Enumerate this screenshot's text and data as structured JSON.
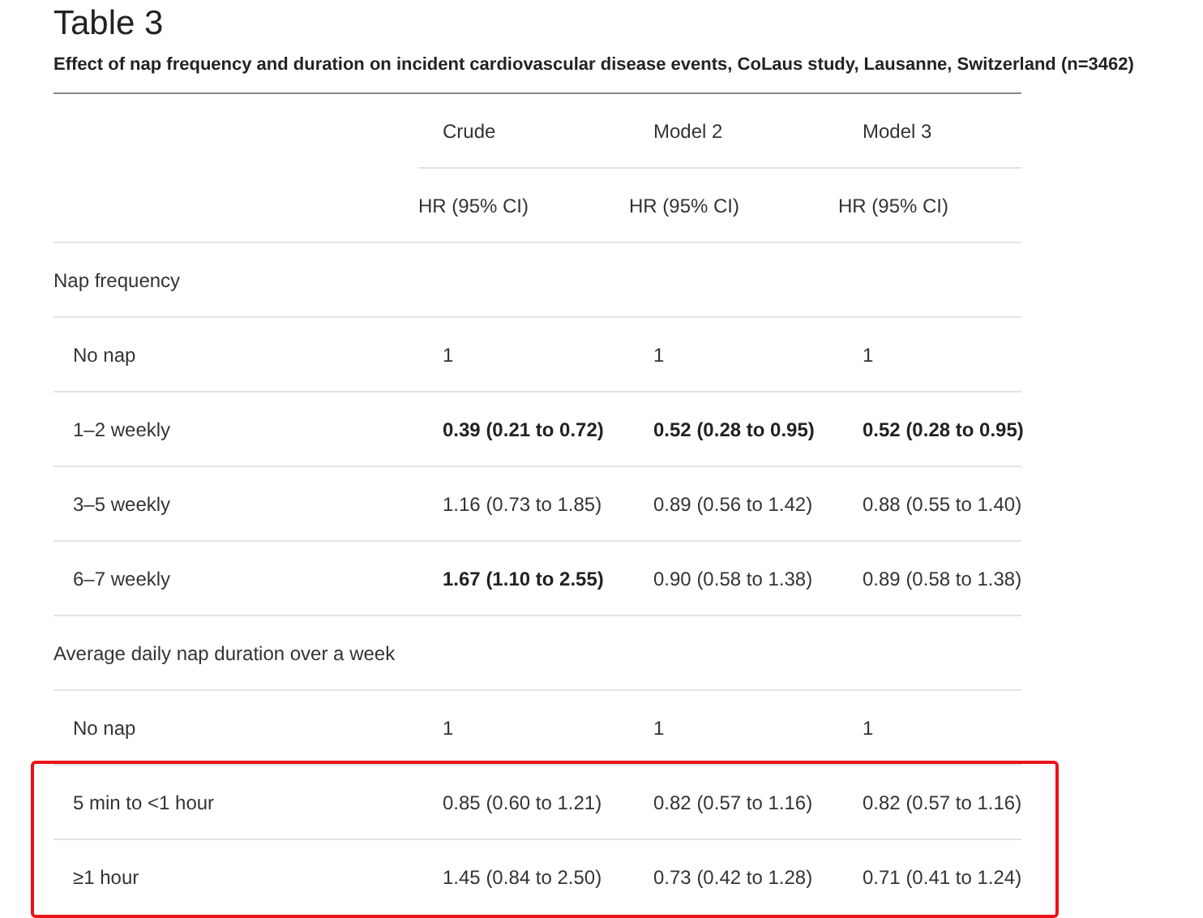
{
  "title": "Table 3",
  "caption": "Effect of nap frequency and duration on incident cardiovascular disease events, CoLaus study, Lausanne, Switzerland (n=3462)",
  "columns": [
    "Crude",
    "Model 2",
    "Model 3"
  ],
  "subheaders": [
    "HR (95% CI)",
    "HR (95% CI)",
    "HR (95% CI)"
  ],
  "rows": [
    {
      "kind": "group",
      "label": "Nap frequency",
      "highlighted": false,
      "cells": []
    },
    {
      "kind": "item",
      "label": "No nap",
      "highlighted": false,
      "cells": [
        {
          "text": "1",
          "bold": false
        },
        {
          "text": "1",
          "bold": false
        },
        {
          "text": "1",
          "bold": false
        }
      ]
    },
    {
      "kind": "item",
      "label": "1–2 weekly",
      "highlighted": false,
      "cells": [
        {
          "text": "0.39 (0.21 to 0.72)",
          "bold": true
        },
        {
          "text": "0.52 (0.28 to 0.95)",
          "bold": true
        },
        {
          "text": "0.52 (0.28 to 0.95)",
          "bold": true
        }
      ]
    },
    {
      "kind": "item",
      "label": "3–5 weekly",
      "highlighted": false,
      "cells": [
        {
          "text": "1.16 (0.73 to 1.85)",
          "bold": false
        },
        {
          "text": "0.89 (0.56 to 1.42)",
          "bold": false
        },
        {
          "text": "0.88 (0.55 to 1.40)",
          "bold": false
        }
      ]
    },
    {
      "kind": "item",
      "label": "6–7 weekly",
      "highlighted": false,
      "cells": [
        {
          "text": "1.67 (1.10 to 2.55)",
          "bold": true
        },
        {
          "text": "0.90 (0.58 to 1.38)",
          "bold": false
        },
        {
          "text": "0.89 (0.58 to 1.38)",
          "bold": false
        }
      ]
    },
    {
      "kind": "group",
      "label": "Average daily nap duration over a week",
      "highlighted": false,
      "cells": []
    },
    {
      "kind": "item",
      "label": "No nap",
      "highlighted": false,
      "cells": [
        {
          "text": "1",
          "bold": false
        },
        {
          "text": "1",
          "bold": false
        },
        {
          "text": "1",
          "bold": false
        }
      ]
    },
    {
      "kind": "item",
      "label": "5 min to <1 hour",
      "highlighted": true,
      "cells": [
        {
          "text": "0.85 (0.60 to 1.21)",
          "bold": false
        },
        {
          "text": "0.82 (0.57 to 1.16)",
          "bold": false
        },
        {
          "text": "0.82 (0.57 to 1.16)",
          "bold": false
        }
      ]
    },
    {
      "kind": "item",
      "label": "≥1 hour",
      "highlighted": true,
      "cells": [
        {
          "text": "1.45 (0.84 to 2.50)",
          "bold": false
        },
        {
          "text": "0.73 (0.42 to 1.28)",
          "bold": false
        },
        {
          "text": "0.71 (0.41 to 1.24)",
          "bold": false
        }
      ]
    }
  ]
}
